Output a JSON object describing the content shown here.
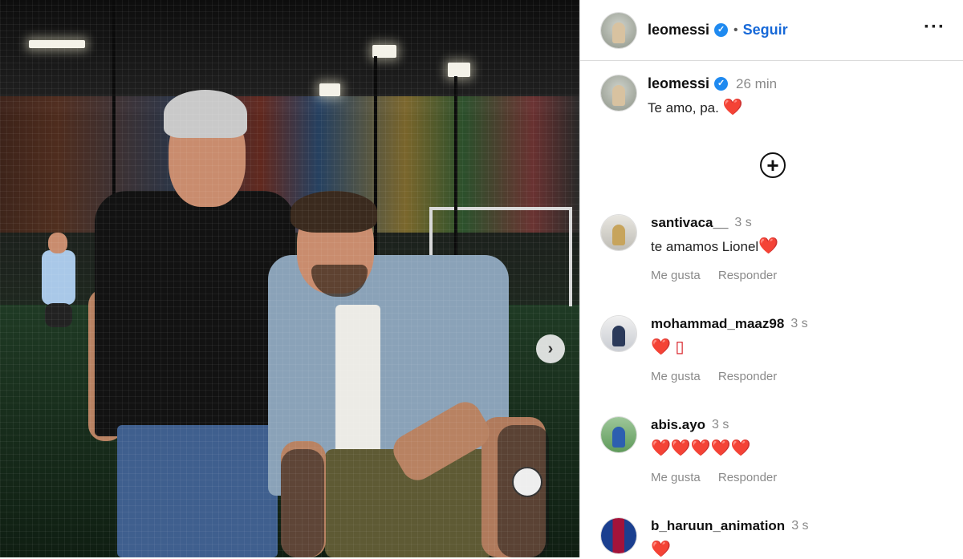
{
  "post": {
    "next_icon": "chevron-right"
  },
  "header": {
    "username": "leomessi",
    "verified_icon": "verified-badge",
    "separator": "•",
    "follow_label": "Seguir",
    "more_label": "···"
  },
  "caption": {
    "username": "leomessi",
    "time": "26 min",
    "text": "Te amo, pa.",
    "emoji": "❤️"
  },
  "load_more_icon": "plus-circle",
  "comments": [
    {
      "username": "santivaca__",
      "time": "3 s",
      "text": "te amamos Lionel",
      "emoji": "❤️",
      "like_label": "Me gusta",
      "reply_label": "Responder"
    },
    {
      "username": "mohammad_maaz98",
      "time": "3 s",
      "text": "",
      "emoji": "❤️ ▯",
      "like_label": "Me gusta",
      "reply_label": "Responder"
    },
    {
      "username": "abis.ayo",
      "time": "3 s",
      "text": "",
      "emoji": "❤️❤️❤️❤️❤️",
      "like_label": "Me gusta",
      "reply_label": "Responder"
    },
    {
      "username": "b_haruun_animation",
      "time": "3 s",
      "text": "",
      "emoji": "❤️"
    }
  ],
  "colors": {
    "accent": "#1769d8",
    "verified": "#1f8af0",
    "heart": "#d6151c",
    "muted": "#8a8a8a"
  }
}
